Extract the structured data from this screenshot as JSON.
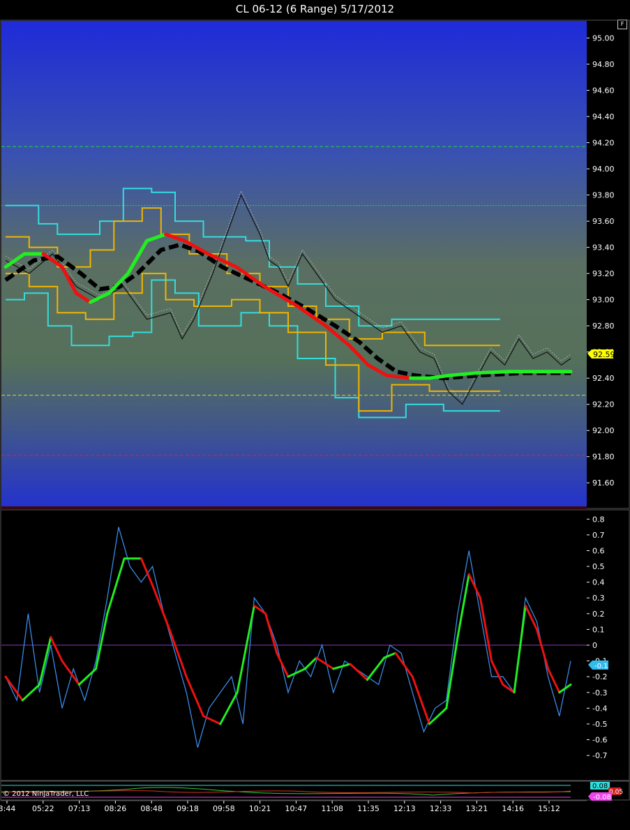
{
  "header": {
    "title": "CL 06-12 (6 Range)  5/17/2012",
    "f_button": "F"
  },
  "copyright": "© 2012 NinjaTrader, LLC",
  "colors": {
    "band_outer": "#33dddd",
    "band_inner": "#f2b400",
    "trend_up": "#22ee22",
    "trend_down": "#ee1111",
    "mid_line": "#000000",
    "osc_raw": "#3a8be8",
    "zero_line": "#9933cc",
    "price_marker": "#ffff00"
  },
  "chart_data": [
    {
      "type": "line",
      "name": "price-panel",
      "ylim": [
        91.42,
        95.12
      ],
      "y_ticks": [
        "95.00",
        "94.80",
        "94.60",
        "94.40",
        "94.20",
        "94.00",
        "93.80",
        "93.60",
        "93.40",
        "93.20",
        "93.00",
        "92.80",
        "92.60",
        "92.40",
        "92.20",
        "92.00",
        "91.80",
        "91.60"
      ],
      "last_price": "92.59",
      "hlines": [
        {
          "value": 94.17,
          "color": "#22cc44",
          "style": "dashed"
        },
        {
          "value": 93.72,
          "color": "#22cc44",
          "style": "dotted"
        },
        {
          "value": 92.27,
          "color": "#cccc22",
          "style": "dashed"
        },
        {
          "value": 91.81,
          "color": "#dd2222",
          "style": "dashed"
        }
      ],
      "price": [
        [
          0,
          93.3
        ],
        [
          10,
          93.2
        ],
        [
          20,
          93.35
        ],
        [
          30,
          93.1
        ],
        [
          40,
          93.0
        ],
        [
          50,
          93.1
        ],
        [
          60,
          92.85
        ],
        [
          70,
          92.9
        ],
        [
          75,
          92.7
        ],
        [
          80,
          92.85
        ],
        [
          88,
          93.2
        ],
        [
          92,
          93.4
        ],
        [
          96,
          93.6
        ],
        [
          100,
          93.8
        ],
        [
          104,
          93.65
        ],
        [
          108,
          93.5
        ],
        [
          112,
          93.3
        ],
        [
          116,
          93.25
        ],
        [
          120,
          93.1
        ],
        [
          126,
          93.35
        ],
        [
          132,
          93.2
        ],
        [
          140,
          93.0
        ],
        [
          148,
          92.9
        ],
        [
          160,
          92.75
        ],
        [
          168,
          92.8
        ],
        [
          176,
          92.6
        ],
        [
          182,
          92.55
        ],
        [
          188,
          92.3
        ],
        [
          194,
          92.2
        ],
        [
          200,
          92.4
        ],
        [
          206,
          92.6
        ],
        [
          212,
          92.5
        ],
        [
          218,
          92.7
        ],
        [
          224,
          92.55
        ],
        [
          230,
          92.6
        ],
        [
          236,
          92.5
        ],
        [
          240,
          92.55
        ]
      ],
      "mid_line": [
        [
          0,
          93.15
        ],
        [
          12,
          93.3
        ],
        [
          22,
          93.33
        ],
        [
          32,
          93.2
        ],
        [
          40,
          93.08
        ],
        [
          48,
          93.1
        ],
        [
          56,
          93.2
        ],
        [
          66,
          93.38
        ],
        [
          74,
          93.42
        ],
        [
          82,
          93.37
        ],
        [
          92,
          93.25
        ],
        [
          104,
          93.15
        ],
        [
          116,
          93.05
        ],
        [
          128,
          92.93
        ],
        [
          140,
          92.8
        ],
        [
          150,
          92.68
        ],
        [
          158,
          92.55
        ],
        [
          166,
          92.45
        ],
        [
          174,
          92.42
        ],
        [
          186,
          92.4
        ],
        [
          200,
          92.42
        ],
        [
          220,
          92.44
        ],
        [
          240,
          92.44
        ]
      ],
      "trend": [
        [
          0,
          93.25
        ],
        [
          8,
          93.35
        ],
        [
          16,
          93.35
        ],
        [
          24,
          93.25
        ],
        [
          30,
          93.05
        ],
        [
          36,
          92.98
        ],
        [
          44,
          93.05
        ],
        [
          52,
          93.2
        ],
        [
          60,
          93.45
        ],
        [
          68,
          93.5
        ],
        [
          76,
          93.45
        ],
        [
          86,
          93.35
        ],
        [
          98,
          93.25
        ],
        [
          110,
          93.1
        ],
        [
          124,
          92.95
        ],
        [
          136,
          92.8
        ],
        [
          146,
          92.65
        ],
        [
          154,
          92.5
        ],
        [
          162,
          92.42
        ],
        [
          172,
          92.4
        ],
        [
          180,
          92.4
        ],
        [
          188,
          92.42
        ],
        [
          200,
          92.44
        ],
        [
          214,
          92.45
        ],
        [
          226,
          92.45
        ],
        [
          240,
          92.45
        ]
      ],
      "band_outer_upper": [
        [
          0,
          93.72
        ],
        [
          14,
          93.72
        ],
        [
          14,
          93.58
        ],
        [
          22,
          93.58
        ],
        [
          22,
          93.5
        ],
        [
          40,
          93.5
        ],
        [
          40,
          93.6
        ],
        [
          50,
          93.6
        ],
        [
          50,
          93.85
        ],
        [
          62,
          93.85
        ],
        [
          62,
          93.82
        ],
        [
          72,
          93.82
        ],
        [
          72,
          93.6
        ],
        [
          84,
          93.6
        ],
        [
          84,
          93.48
        ],
        [
          102,
          93.48
        ],
        [
          102,
          93.45
        ],
        [
          112,
          93.45
        ],
        [
          112,
          93.25
        ],
        [
          124,
          93.25
        ],
        [
          124,
          93.12
        ],
        [
          136,
          93.12
        ],
        [
          136,
          92.95
        ],
        [
          150,
          92.95
        ],
        [
          150,
          92.8
        ],
        [
          164,
          92.8
        ],
        [
          164,
          92.85
        ],
        [
          180,
          92.85
        ],
        [
          180,
          92.85
        ],
        [
          210,
          92.85
        ]
      ],
      "band_outer_lower": [
        [
          0,
          93.0
        ],
        [
          8,
          93.0
        ],
        [
          8,
          93.05
        ],
        [
          18,
          93.05
        ],
        [
          18,
          92.8
        ],
        [
          28,
          92.8
        ],
        [
          28,
          92.65
        ],
        [
          44,
          92.65
        ],
        [
          44,
          92.72
        ],
        [
          54,
          92.72
        ],
        [
          54,
          92.75
        ],
        [
          62,
          92.75
        ],
        [
          62,
          93.15
        ],
        [
          72,
          93.15
        ],
        [
          72,
          93.05
        ],
        [
          82,
          93.05
        ],
        [
          82,
          92.8
        ],
        [
          100,
          92.8
        ],
        [
          100,
          92.9
        ],
        [
          112,
          92.9
        ],
        [
          112,
          92.8
        ],
        [
          124,
          92.8
        ],
        [
          124,
          92.55
        ],
        [
          140,
          92.55
        ],
        [
          140,
          92.25
        ],
        [
          150,
          92.25
        ],
        [
          150,
          92.1
        ],
        [
          170,
          92.1
        ],
        [
          170,
          92.2
        ],
        [
          186,
          92.2
        ],
        [
          186,
          92.15
        ],
        [
          210,
          92.15
        ]
      ],
      "band_inner_upper": [
        [
          0,
          93.48
        ],
        [
          10,
          93.48
        ],
        [
          10,
          93.4
        ],
        [
          22,
          93.4
        ],
        [
          22,
          93.25
        ],
        [
          36,
          93.25
        ],
        [
          36,
          93.38
        ],
        [
          46,
          93.38
        ],
        [
          46,
          93.6
        ],
        [
          58,
          93.6
        ],
        [
          58,
          93.7
        ],
        [
          66,
          93.7
        ],
        [
          66,
          93.5
        ],
        [
          78,
          93.5
        ],
        [
          78,
          93.35
        ],
        [
          94,
          93.35
        ],
        [
          94,
          93.2
        ],
        [
          108,
          93.2
        ],
        [
          108,
          93.1
        ],
        [
          120,
          93.1
        ],
        [
          120,
          92.95
        ],
        [
          132,
          92.95
        ],
        [
          132,
          92.85
        ],
        [
          146,
          92.85
        ],
        [
          146,
          92.7
        ],
        [
          160,
          92.7
        ],
        [
          160,
          92.75
        ],
        [
          178,
          92.75
        ],
        [
          178,
          92.65
        ],
        [
          210,
          92.65
        ]
      ],
      "band_inner_lower": [
        [
          0,
          93.2
        ],
        [
          10,
          93.2
        ],
        [
          10,
          93.1
        ],
        [
          22,
          93.1
        ],
        [
          22,
          92.9
        ],
        [
          34,
          92.9
        ],
        [
          34,
          92.85
        ],
        [
          46,
          92.85
        ],
        [
          46,
          93.05
        ],
        [
          58,
          93.05
        ],
        [
          58,
          93.2
        ],
        [
          68,
          93.2
        ],
        [
          68,
          93.0
        ],
        [
          80,
          93.0
        ],
        [
          80,
          92.95
        ],
        [
          96,
          92.95
        ],
        [
          96,
          93.0
        ],
        [
          108,
          93.0
        ],
        [
          108,
          92.9
        ],
        [
          120,
          92.9
        ],
        [
          120,
          92.75
        ],
        [
          136,
          92.75
        ],
        [
          136,
          92.5
        ],
        [
          150,
          92.5
        ],
        [
          150,
          92.15
        ],
        [
          164,
          92.15
        ],
        [
          164,
          92.35
        ],
        [
          180,
          92.35
        ],
        [
          180,
          92.3
        ],
        [
          210,
          92.3
        ]
      ]
    },
    {
      "type": "line",
      "name": "oscillator-panel",
      "ylim": [
        -0.85,
        0.85
      ],
      "y_ticks": [
        "0.8",
        "0.7",
        "0.6",
        "0.5",
        "0.4",
        "0.3",
        "0.2",
        "0.1",
        "0",
        "-0.1",
        "-0.2",
        "-0.3",
        "-0.4",
        "-0.5",
        "-0.6",
        "-0.7"
      ],
      "last_value": "-0.1",
      "zero_line": 0,
      "raw": [
        [
          0,
          -0.2
        ],
        [
          4,
          -0.35
        ],
        [
          8,
          0.2
        ],
        [
          12,
          -0.3
        ],
        [
          16,
          0.0
        ],
        [
          20,
          -0.4
        ],
        [
          24,
          -0.15
        ],
        [
          28,
          -0.35
        ],
        [
          32,
          -0.1
        ],
        [
          36,
          0.3
        ],
        [
          40,
          0.75
        ],
        [
          44,
          0.5
        ],
        [
          48,
          0.4
        ],
        [
          52,
          0.5
        ],
        [
          56,
          0.2
        ],
        [
          60,
          -0.05
        ],
        [
          64,
          -0.3
        ],
        [
          68,
          -0.65
        ],
        [
          72,
          -0.4
        ],
        [
          76,
          -0.3
        ],
        [
          80,
          -0.2
        ],
        [
          84,
          -0.5
        ],
        [
          88,
          0.3
        ],
        [
          92,
          0.2
        ],
        [
          96,
          0.0
        ],
        [
          100,
          -0.3
        ],
        [
          104,
          -0.1
        ],
        [
          108,
          -0.2
        ],
        [
          112,
          0.0
        ],
        [
          116,
          -0.3
        ],
        [
          120,
          -0.1
        ],
        [
          124,
          -0.15
        ],
        [
          128,
          -0.2
        ],
        [
          132,
          -0.25
        ],
        [
          136,
          0.0
        ],
        [
          140,
          -0.05
        ],
        [
          144,
          -0.3
        ],
        [
          148,
          -0.55
        ],
        [
          152,
          -0.4
        ],
        [
          156,
          -0.35
        ],
        [
          160,
          0.2
        ],
        [
          164,
          0.6
        ],
        [
          168,
          0.2
        ],
        [
          172,
          -0.2
        ],
        [
          176,
          -0.2
        ],
        [
          180,
          -0.3
        ],
        [
          184,
          0.3
        ],
        [
          188,
          0.15
        ],
        [
          192,
          -0.2
        ],
        [
          196,
          -0.45
        ],
        [
          200,
          -0.1
        ]
      ],
      "smooth": [
        [
          0,
          -0.2
        ],
        [
          6,
          -0.35
        ],
        [
          12,
          -0.25
        ],
        [
          16,
          0.05
        ],
        [
          20,
          -0.1
        ],
        [
          26,
          -0.25
        ],
        [
          32,
          -0.15
        ],
        [
          36,
          0.2
        ],
        [
          42,
          0.55
        ],
        [
          48,
          0.55
        ],
        [
          52,
          0.38
        ],
        [
          58,
          0.1
        ],
        [
          64,
          -0.2
        ],
        [
          70,
          -0.45
        ],
        [
          76,
          -0.5
        ],
        [
          82,
          -0.3
        ],
        [
          88,
          0.25
        ],
        [
          92,
          0.2
        ],
        [
          96,
          -0.05
        ],
        [
          100,
          -0.2
        ],
        [
          106,
          -0.15
        ],
        [
          110,
          -0.08
        ],
        [
          116,
          -0.15
        ],
        [
          122,
          -0.12
        ],
        [
          128,
          -0.22
        ],
        [
          134,
          -0.08
        ],
        [
          138,
          -0.05
        ],
        [
          144,
          -0.2
        ],
        [
          150,
          -0.5
        ],
        [
          156,
          -0.4
        ],
        [
          160,
          0.05
        ],
        [
          164,
          0.45
        ],
        [
          168,
          0.3
        ],
        [
          172,
          -0.1
        ],
        [
          176,
          -0.25
        ],
        [
          180,
          -0.3
        ],
        [
          184,
          0.25
        ],
        [
          188,
          0.1
        ],
        [
          192,
          -0.15
        ],
        [
          196,
          -0.3
        ],
        [
          200,
          -0.25
        ]
      ]
    },
    {
      "type": "line",
      "name": "lower-panel",
      "labels": [
        "0.08",
        "-0.08"
      ],
      "value_tag": "0.05"
    }
  ],
  "x_ticks": [
    "3:44",
    "05:22",
    "07:13",
    "08:26",
    "08:48",
    "09:18",
    "09:58",
    "10:21",
    "10:47",
    "11:08",
    "11:35",
    "12:13",
    "12:33",
    "13:21",
    "14:16",
    "15:12"
  ]
}
